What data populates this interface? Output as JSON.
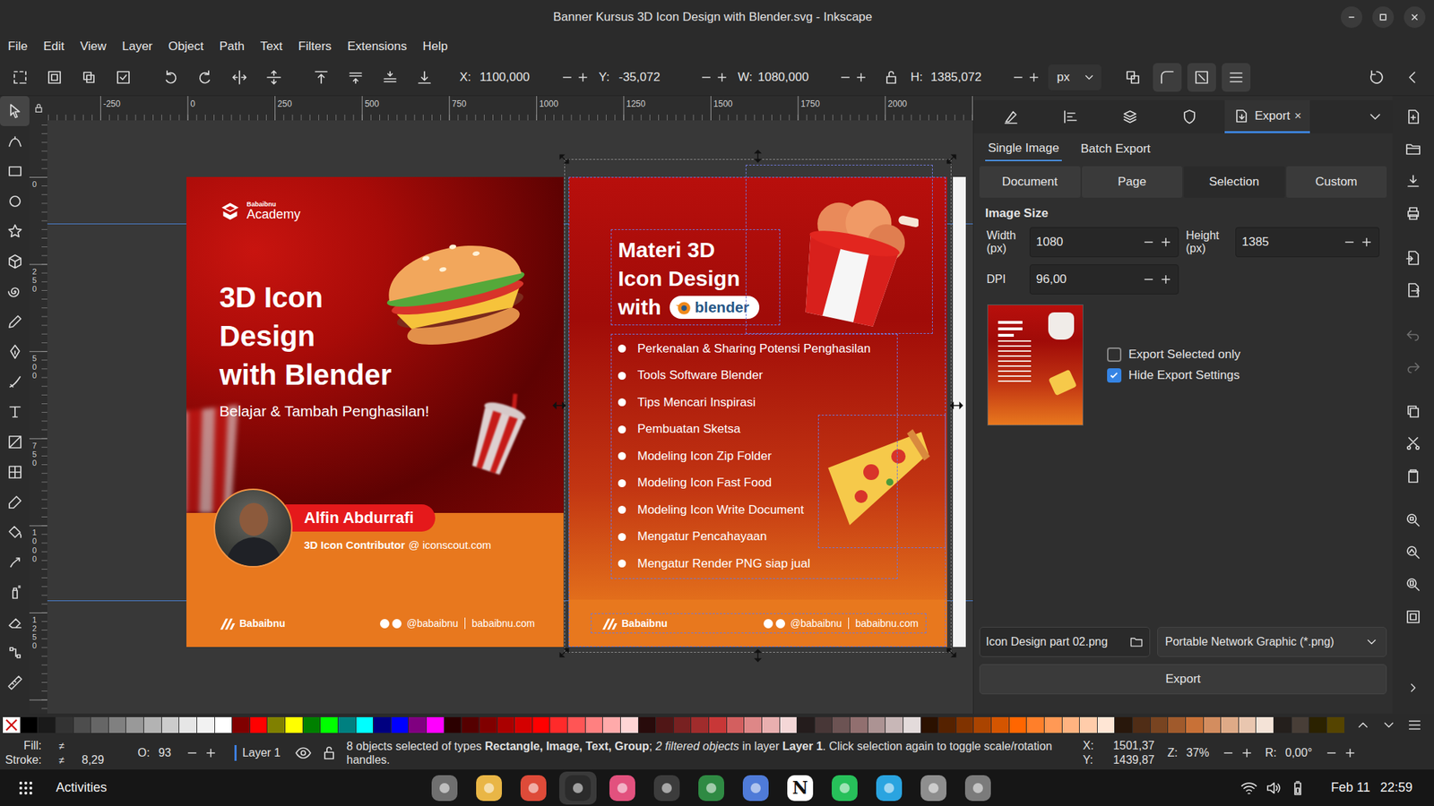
{
  "window": {
    "title": "Banner Kursus 3D Icon Design with Blender.svg - Inkscape"
  },
  "menu": [
    "File",
    "Edit",
    "View",
    "Layer",
    "Object",
    "Path",
    "Text",
    "Filters",
    "Extensions",
    "Help"
  ],
  "toolbar": {
    "fields": [
      {
        "label": "X:",
        "value": "1100,000"
      },
      {
        "label": "Y:",
        "value": "-35,072"
      },
      {
        "label": "W:",
        "value": "1080,000"
      },
      {
        "label": "H:",
        "value": "1385,072"
      }
    ],
    "locked": false,
    "unit": "px",
    "toggles": [
      {
        "on": false
      },
      {
        "on": true
      },
      {
        "on": true
      },
      {
        "on": true
      }
    ]
  },
  "tools": [
    {
      "selected": true
    },
    {
      "selected": false
    },
    {
      "selected": false
    },
    {
      "selected": false
    },
    {
      "selected": false
    },
    {
      "selected": false
    },
    {
      "selected": false
    },
    {
      "selected": false
    },
    {
      "selected": false
    },
    {
      "selected": false
    },
    {
      "selected": false
    },
    {
      "selected": false
    },
    {
      "selected": false
    },
    {
      "selected": false
    },
    {
      "selected": false
    },
    {
      "selected": false
    },
    {
      "selected": false
    },
    {
      "selected": false
    },
    {
      "selected": false
    },
    {
      "selected": false
    }
  ],
  "rulers": {
    "top": [
      "-250",
      "0",
      "250",
      "500",
      "750",
      "1000",
      "1250",
      "1500",
      "1750",
      "2000"
    ],
    "left": [
      "0",
      "250",
      "500",
      "750",
      "1000",
      "1250"
    ]
  },
  "banner_intro": {
    "logo_small": "Babaibnu",
    "logo_name": "Academy",
    "title": [
      "3D Icon",
      "Design",
      "with Blender"
    ],
    "subtitle": "Belajar & Tambah Penghasilan!",
    "author": "Alfin Abdurrafi",
    "role": "3D Icon Contributor",
    "role_site": "@ iconscout.com",
    "footer": {
      "brand": "Babaibnu",
      "handle": "@babaibnu",
      "site": "babaibnu.com"
    }
  },
  "banner_syllabus": {
    "title": [
      "Materi 3D",
      "Icon Design",
      "with"
    ],
    "badge": "blender",
    "items": [
      "Perkenalan & Sharing Potensi Penghasilan",
      "Tools Software Blender",
      "Tips Mencari Inspirasi",
      "Pembuatan Sketsa",
      "Modeling Icon Zip Folder",
      "Modeling Icon Fast Food",
      "Modeling Icon Write Document",
      "Mengatur Pencahayaan",
      "Mengatur Render PNG siap jual"
    ],
    "footer": {
      "brand": "Babaibnu",
      "handle": "@babaibnu",
      "site": "babaibnu.com"
    }
  },
  "dock": {
    "tabs": [
      {
        "kind": "icon",
        "selected": false
      },
      {
        "kind": "icon",
        "selected": false
      },
      {
        "kind": "icon",
        "selected": false
      },
      {
        "kind": "icon",
        "selected": false
      },
      {
        "kind": "labeled",
        "label": "Export",
        "close": "×",
        "selected": true
      }
    ],
    "subtabs": [
      {
        "label": "Single Image",
        "selected": true
      },
      {
        "label": "Batch Export",
        "selected": false
      }
    ],
    "areas": [
      {
        "label": "Document",
        "selected": false
      },
      {
        "label": "Page",
        "selected": false
      },
      {
        "label": "Selection",
        "selected": true
      },
      {
        "label": "Custom",
        "selected": false
      }
    ],
    "heading": "Image Size",
    "width": {
      "label": [
        "Width",
        "(px)"
      ],
      "value": "1080"
    },
    "height": {
      "label": [
        "Height",
        "(px)"
      ],
      "value": "1385"
    },
    "dpi": {
      "label": "DPI",
      "value": "96,00"
    },
    "checks": [
      {
        "label": "Export Selected only",
        "checked": false
      },
      {
        "label": "Hide Export Settings",
        "checked": true
      }
    ],
    "filename": "Icon Design part 02.png",
    "format": "Portable Network Graphic (*.png)",
    "button": "Export"
  },
  "commands": [
    [
      {
        "disabled": false
      },
      {
        "disabled": false
      },
      {
        "disabled": false
      },
      {
        "disabled": false
      }
    ],
    [
      {
        "disabled": false
      },
      {
        "disabled": false
      }
    ],
    [
      {
        "disabled": true
      },
      {
        "disabled": true
      }
    ],
    [
      {
        "disabled": false
      },
      {
        "disabled": false
      },
      {
        "disabled": false
      }
    ],
    [
      {
        "disabled": false
      },
      {
        "disabled": false
      },
      {
        "disabled": false
      },
      {
        "disabled": false
      }
    ]
  ],
  "palette": [
    {
      "kind": "none"
    },
    {
      "kind": "color",
      "color": "#000000"
    },
    {
      "kind": "color",
      "color": "#1a1a1a"
    },
    {
      "kind": "color",
      "color": "#333333"
    },
    {
      "kind": "color",
      "color": "#4d4d4d"
    },
    {
      "kind": "color",
      "color": "#666666"
    },
    {
      "kind": "color",
      "color": "#808080"
    },
    {
      "kind": "color",
      "color": "#999999"
    },
    {
      "kind": "color",
      "color": "#b3b3b3"
    },
    {
      "kind": "color",
      "color": "#cccccc"
    },
    {
      "kind": "color",
      "color": "#e6e6e6"
    },
    {
      "kind": "color",
      "color": "#f2f2f2"
    },
    {
      "kind": "color",
      "color": "#ffffff"
    },
    {
      "kind": "color",
      "color": "#800000"
    },
    {
      "kind": "color",
      "color": "#ff0000"
    },
    {
      "kind": "color",
      "color": "#808000"
    },
    {
      "kind": "color",
      "color": "#ffff00"
    },
    {
      "kind": "color",
      "color": "#008000"
    },
    {
      "kind": "color",
      "color": "#00ff00"
    },
    {
      "kind": "color",
      "color": "#008080"
    },
    {
      "kind": "color",
      "color": "#00ffff"
    },
    {
      "kind": "color",
      "color": "#000080"
    },
    {
      "kind": "color",
      "color": "#0000ff"
    },
    {
      "kind": "color",
      "color": "#800080"
    },
    {
      "kind": "color",
      "color": "#ff00ff"
    },
    {
      "kind": "color",
      "color": "#2b0000"
    },
    {
      "kind": "color",
      "color": "#550000"
    },
    {
      "kind": "color",
      "color": "#800000"
    },
    {
      "kind": "color",
      "color": "#aa0000"
    },
    {
      "kind": "color",
      "color": "#d40000"
    },
    {
      "kind": "color",
      "color": "#ff0000"
    },
    {
      "kind": "color",
      "color": "#ff2a2a"
    },
    {
      "kind": "color",
      "color": "#ff5555"
    },
    {
      "kind": "color",
      "color": "#ff8080"
    },
    {
      "kind": "color",
      "color": "#ffaaaa"
    },
    {
      "kind": "color",
      "color": "#ffd5d5"
    },
    {
      "kind": "color",
      "color": "#280b0b"
    },
    {
      "kind": "color",
      "color": "#501616"
    },
    {
      "kind": "color",
      "color": "#782121"
    },
    {
      "kind": "color",
      "color": "#a02c2c"
    },
    {
      "kind": "color",
      "color": "#c83737"
    },
    {
      "kind": "color",
      "color": "#d35f5f"
    },
    {
      "kind": "color",
      "color": "#de8787"
    },
    {
      "kind": "color",
      "color": "#e9afaf"
    },
    {
      "kind": "color",
      "color": "#f4d7d7"
    },
    {
      "kind": "color",
      "color": "#241c1c"
    },
    {
      "kind": "color",
      "color": "#483737"
    },
    {
      "kind": "color",
      "color": "#6c5353"
    },
    {
      "kind": "color",
      "color": "#916f6f"
    },
    {
      "kind": "color",
      "color": "#ac9393"
    },
    {
      "kind": "color",
      "color": "#c8b7b7"
    },
    {
      "kind": "color",
      "color": "#e3dbdb"
    },
    {
      "kind": "color",
      "color": "#2b1100"
    },
    {
      "kind": "color",
      "color": "#552200"
    },
    {
      "kind": "color",
      "color": "#803300"
    },
    {
      "kind": "color",
      "color": "#aa4400"
    },
    {
      "kind": "color",
      "color": "#d45500"
    },
    {
      "kind": "color",
      "color": "#ff6600"
    },
    {
      "kind": "color",
      "color": "#ff7f2a"
    },
    {
      "kind": "color",
      "color": "#ff9955"
    },
    {
      "kind": "color",
      "color": "#ffb380"
    },
    {
      "kind": "color",
      "color": "#ffccaa"
    },
    {
      "kind": "color",
      "color": "#ffe6d5"
    },
    {
      "kind": "color",
      "color": "#28170b"
    },
    {
      "kind": "color",
      "color": "#502d16"
    },
    {
      "kind": "color",
      "color": "#784421"
    },
    {
      "kind": "color",
      "color": "#a05a2c"
    },
    {
      "kind": "color",
      "color": "#c87137"
    },
    {
      "kind": "color",
      "color": "#d38d5f"
    },
    {
      "kind": "color",
      "color": "#deaa87"
    },
    {
      "kind": "color",
      "color": "#e9c6af"
    },
    {
      "kind": "color",
      "color": "#f4e3d7"
    },
    {
      "kind": "color",
      "color": "#241f1c"
    },
    {
      "kind": "color",
      "color": "#483e37"
    },
    {
      "kind": "color",
      "color": "#2b2200"
    },
    {
      "kind": "color",
      "color": "#554400"
    }
  ],
  "status_bar": {
    "fill": {
      "label": "Fill:",
      "value": "≠"
    },
    "stroke": {
      "label": "Stroke:",
      "value": "≠",
      "width": "8,29"
    },
    "opacity": {
      "label": "O:",
      "value": "93"
    },
    "layer": "Layer 1",
    "message": [
      {
        "text": "8 objects selected of types ",
        "style": "normal"
      },
      {
        "text": "Rectangle, Image, Text, Group",
        "style": "bold"
      },
      {
        "text": "; ",
        "style": "normal"
      },
      {
        "text": "2 filtered objects",
        "style": "italic"
      },
      {
        "text": " in layer ",
        "style": "normal"
      },
      {
        "text": "Layer 1",
        "style": "bold"
      },
      {
        "text": ". Click selection again to toggle scale/rotation handles.",
        "style": "normal"
      }
    ],
    "x_label": "X:",
    "x": "1501,37",
    "y_label": "Y:",
    "y": "1439,87",
    "zoom": {
      "label": "Z:",
      "value": "37%"
    },
    "rotation": {
      "label": "R:",
      "value": "0,00°"
    }
  },
  "taskbar": {
    "activities": "Activities",
    "apps": [
      {
        "color": "#6f6f6f",
        "active": false
      },
      {
        "color": "#e9b646",
        "active": false
      },
      {
        "color": "#de4b39",
        "active": false
      },
      {
        "color": "#2b2b2b",
        "active": true
      },
      {
        "color": "#e2517e",
        "active": false
      },
      {
        "color": "#3c3c3c",
        "active": false
      },
      {
        "color": "#2f8a43",
        "active": false
      },
      {
        "color": "#4f7bd8",
        "active": false
      },
      {
        "color": "#ffffff",
        "glyph": "N",
        "active": false
      },
      {
        "color": "#27c05a",
        "active": false
      },
      {
        "color": "#2aa4e0",
        "active": false
      },
      {
        "color": "#8e8e8e",
        "active": false
      },
      {
        "color": "#7b7b7b",
        "active": false
      }
    ],
    "date": "Feb 11",
    "time": "22:59"
  }
}
